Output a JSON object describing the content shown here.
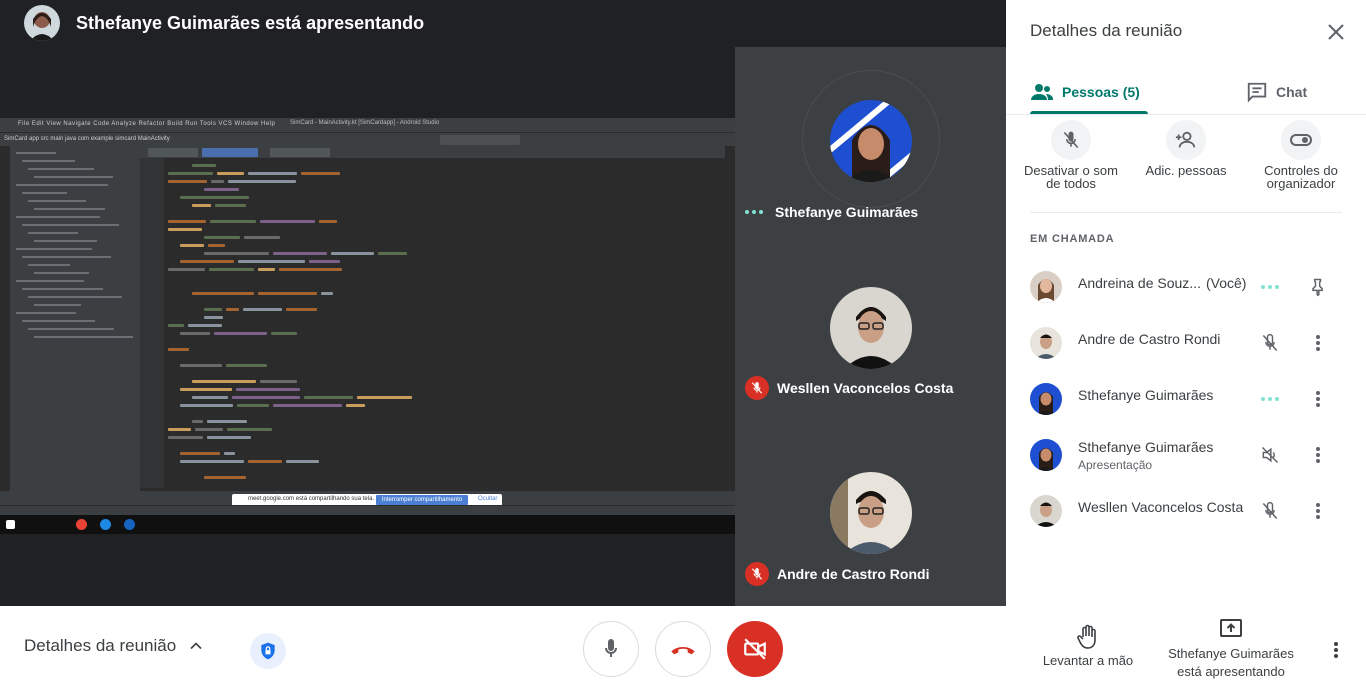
{
  "stage": {
    "presenter_title": "Sthefanye Guimarães está apresentando"
  },
  "tiles": [
    {
      "name": "Sthefanye Guimarães",
      "state": "speaking"
    },
    {
      "name": "Wesllen Vaconcelos Costa",
      "state": "muted"
    },
    {
      "name": "Andre de Castro Rondi",
      "state": "muted"
    }
  ],
  "panel": {
    "title": "Detalhes da reunião",
    "tabs": {
      "people": "Pessoas (5)",
      "chat": "Chat"
    },
    "actions": {
      "mute_all": "Desativar o som de todos",
      "add_people": "Adic. pessoas",
      "host_controls": "Controles do organizador"
    },
    "section_label": "EM CHAMADA",
    "participants": [
      {
        "name": "Andreina de Souz...",
        "tag": "(Você)",
        "status": "speaking"
      },
      {
        "name": "Andre de Castro Rondi",
        "status": "muted"
      },
      {
        "name": "Sthefanye Guimarães",
        "status": "speaking"
      },
      {
        "name": "Sthefanye Guimarães",
        "sub": "Apresentação",
        "status": "audio-off"
      },
      {
        "name": "Wesllen Vaconcelos Costa",
        "status": "muted"
      }
    ]
  },
  "bottom": {
    "meeting_details": "Detalhes da reunião",
    "raise_hand": "Levantar a mão",
    "presenting": "Sthefanye Guimarães está apresentando"
  },
  "shared_screen": {
    "window_title": "SimCard - MainActivity.kt [SimCardapp] - Android Studio",
    "menu": "File  Edit  View  Navigate  Code  Analyze  Refactor  Build  Run  Tools  VCS  Window  Help",
    "breadcrumb": "SimCard  app  src  main  java  com  example  simcard  MainActivity",
    "share_notice": "meet.google.com está compartilhando sua tela.",
    "share_stop": "Interromper compartilhamento",
    "share_hide": "Ocultar"
  },
  "colors": {
    "accent": "#00796b",
    "danger": "#d93025",
    "speaking": "#81e1d2",
    "stage": "#202124"
  }
}
